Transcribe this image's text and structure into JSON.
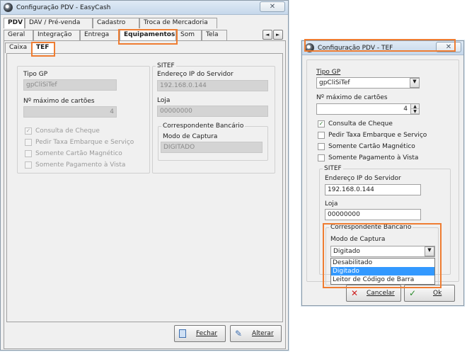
{
  "main_window": {
    "title": "Configuração PDV - EasyCash",
    "close_label": "✕",
    "tabs_row1": [
      "PDV",
      "DAV / Pré-venda",
      "Cadastro",
      "Troca de Mercadoria"
    ],
    "tabs_row2": [
      "Geral",
      "Integração",
      "Entrega",
      "Equipamentos",
      "Som",
      "Tela"
    ],
    "tabs_row3": [
      "Caixa",
      "TEF"
    ],
    "scroll_left": "◄",
    "scroll_right": "►",
    "tipo_gp_label": "Tipo GP",
    "tipo_gp_value": "gpCliSiTef",
    "max_cartoes_label": "Nº máximo de cartões",
    "max_cartoes_value": "4",
    "check_consulta": "Consulta de Cheque",
    "check_taxa": "Pedir Taxa Embarque e Serviço",
    "check_magnetico": "Somente Cartão Magnético",
    "check_vista": "Somente Pagamento à Vista",
    "sitef_label": "SITEF",
    "ip_label": "Endereço IP do Servidor",
    "ip_value": "192.168.0.144",
    "loja_label": "Loja",
    "loja_value": "00000000",
    "correspondente_label": "Correspondente Bancário",
    "modo_label": "Modo de Captura",
    "modo_value": "DIGITADO",
    "fechar_label": "Fechar",
    "alterar_label": "Alterar"
  },
  "tef_dialog": {
    "title": "Configuração PDV - TEF",
    "close_label": "✕",
    "tipo_gp_label": "Tipo GP",
    "tipo_gp_value": "gpCliSiTef",
    "max_cartoes_label": "Nº máximo de cartões",
    "max_cartoes_value": "4",
    "check_consulta": "Consulta de Cheque",
    "check_taxa": "Pedir Taxa Embarque e Serviço",
    "check_magnetico": "Somente Cartão Magnético",
    "check_vista": "Somente Pagamento à Vista",
    "sitef_label": "SITEF",
    "ip_label": "Endereço IP do Servidor",
    "ip_value": "192.168.0.144",
    "loja_label": "Loja",
    "loja_value": "00000000",
    "correspondente_label": "Correspondente Bancário",
    "modo_label": "Modo de Captura",
    "modo_value": "Digitado",
    "options": [
      "Desabilitado",
      "Digitado",
      "Leitor de Código de Barra"
    ],
    "cancelar_label": "Cancelar",
    "ok_label": "Ok"
  },
  "colors": {
    "highlight": "#ef7d32",
    "selection": "#3399ff"
  }
}
